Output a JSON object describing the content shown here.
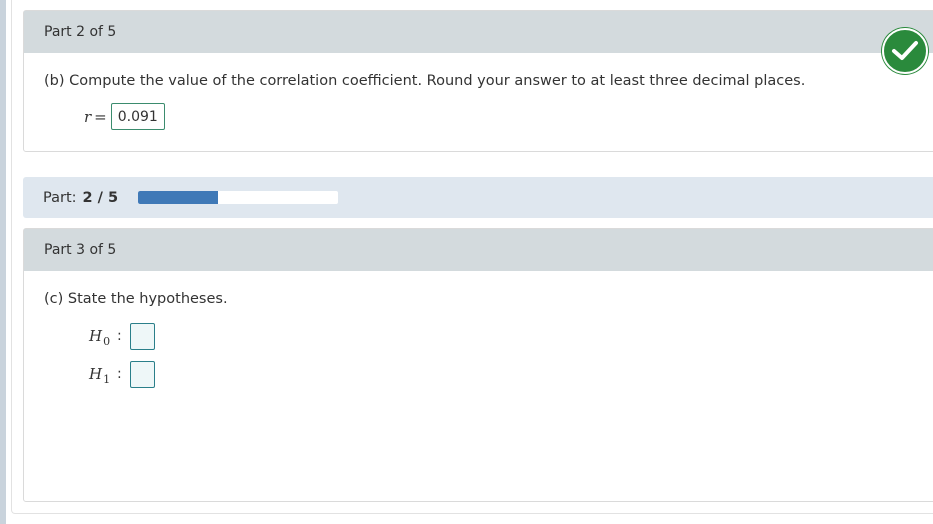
{
  "part2": {
    "header": "Part 2 of 5",
    "question": "(b) Compute the value of the correlation coefficient. Round your answer to at least three decimal places.",
    "variable": "r",
    "equals": "=",
    "answer": "0.091",
    "status_icon": "check-icon",
    "status_color": "#2a8a3c"
  },
  "progress": {
    "label": "Part:",
    "value_text": "2 / 5",
    "fraction": 0.4,
    "fill_color": "#3f79b7"
  },
  "part3": {
    "header": "Part 3 of 5",
    "question": "(c) State the hypotheses.",
    "hypotheses": [
      {
        "symbol": "H",
        "subscript": "0",
        "colon": ":",
        "value": ""
      },
      {
        "symbol": "H",
        "subscript": "1",
        "colon": ":",
        "value": ""
      }
    ]
  }
}
